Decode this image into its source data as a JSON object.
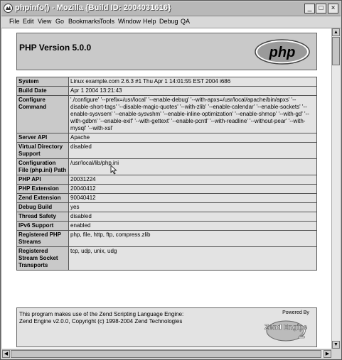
{
  "window": {
    "title": "phpinfo() - Mozilla {Build ID: 2004031616}",
    "controls": [
      "_",
      "□",
      "×"
    ]
  },
  "menu": [
    "File",
    "Edit",
    "View",
    "Go",
    "Bookmarks",
    "Tools",
    "Window",
    "Help",
    "Debug",
    "QA"
  ],
  "header": {
    "version": "PHP Version 5.0.0",
    "logo_text": "php"
  },
  "info_rows": [
    {
      "key": "System",
      "value": "Linux example.com 2.6.3 #1 Thu Apr 1 14:01:55 EST 2004 i686"
    },
    {
      "key": "Build Date",
      "value": "Apr 1 2004 13:21:43"
    },
    {
      "key": "Configure Command",
      "value": "'./configure' '--prefix=/usr/local' '--enable-debug' '--with-apxs=/usr/local/apache/bin/apxs' '--disable-short-tags' '--disable-magic-quotes' '--with-zlib' '--enable-calendar' '--enable-sockets' '--enable-sysvsem' '--enable-sysvshm' '--enable-inline-optimization' '--enable-shmop' '--with-gd' '--with-gdbm' '--enable-exif' '--with-gettext' '--enable-pcntl' '--with-readline' '--without-pear' '--with-mysql' '--with-xsl'"
    },
    {
      "key": "Server API",
      "value": "Apache"
    },
    {
      "key": "Virtual Directory Support",
      "value": "disabled"
    },
    {
      "key": "Configuration File (php.ini) Path",
      "value": "/usr/local/lib/php.ini"
    },
    {
      "key": "PHP API",
      "value": "20031224"
    },
    {
      "key": "PHP Extension",
      "value": "20040412"
    },
    {
      "key": "Zend Extension",
      "value": "90040412"
    },
    {
      "key": "Debug Build",
      "value": "yes"
    },
    {
      "key": "Thread Safety",
      "value": "disabled"
    },
    {
      "key": "IPv6 Support",
      "value": "enabled"
    },
    {
      "key": "Registered PHP Streams",
      "value": "php, file, http, ftp, compress.zlib"
    },
    {
      "key": "Registered Stream Socket Transports",
      "value": "tcp, udp, unix, udg"
    }
  ],
  "footer": {
    "line1": "This program makes use of the Zend Scripting Language Engine:",
    "line2": "Zend Engine v2.0.0, Copyright (c) 1998-2004 Zend Technologies",
    "powered_by": "Powered By",
    "engine_text": "Zend Engine",
    "engine_version": "2"
  }
}
